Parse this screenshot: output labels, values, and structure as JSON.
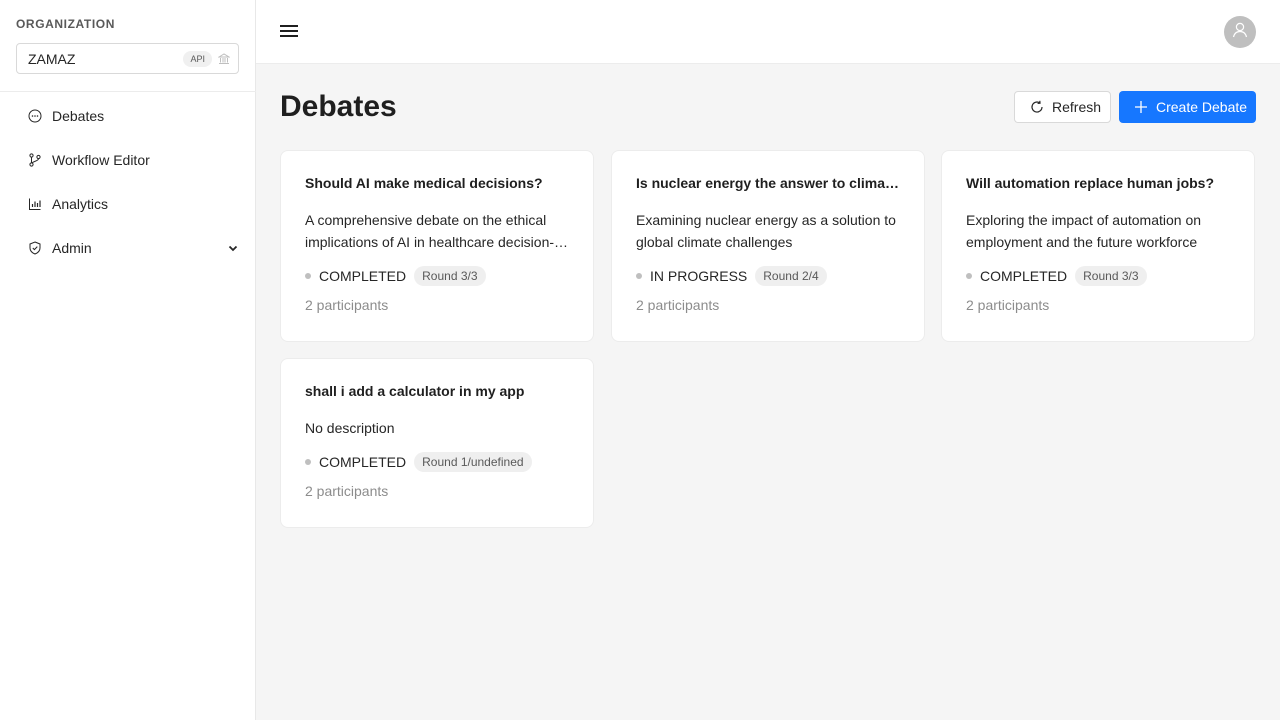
{
  "sidebar": {
    "org_label": "ORGANIZATION",
    "org_name": "ZAMAZ",
    "org_tag": "API",
    "items": [
      {
        "label": "Debates",
        "icon": "chat-bubble-icon"
      },
      {
        "label": "Workflow Editor",
        "icon": "branch-icon"
      },
      {
        "label": "Analytics",
        "icon": "bar-chart-icon"
      },
      {
        "label": "Admin",
        "icon": "shield-check-icon"
      }
    ]
  },
  "header": {
    "menu_icon": "hamburger-icon",
    "avatar_icon": "user-icon"
  },
  "main": {
    "title": "Debates",
    "refresh_label": "Refresh",
    "create_label": "Create Debate",
    "accent_color": "#1677ff"
  },
  "cards": [
    {
      "title": "Should AI make medical decisions?",
      "description": "A comprehensive debate on the ethical implications of AI in healthcare decision-making",
      "status": "COMPLETED",
      "round": "Round 3/3",
      "participants": "2 participants"
    },
    {
      "title": "Is nuclear energy the answer to climate change?",
      "description": "Examining nuclear energy as a solution to global climate challenges",
      "status": "IN PROGRESS",
      "round": "Round 2/4",
      "participants": "2 participants"
    },
    {
      "title": "Will automation replace human jobs?",
      "description": "Exploring the impact of automation on employment and the future workforce",
      "status": "COMPLETED",
      "round": "Round 3/3",
      "participants": "2 participants"
    },
    {
      "title": "shall i add a calculator in my app",
      "description": "No description",
      "status": "COMPLETED",
      "round": "Round 1/undefined",
      "participants": "2 participants"
    }
  ]
}
